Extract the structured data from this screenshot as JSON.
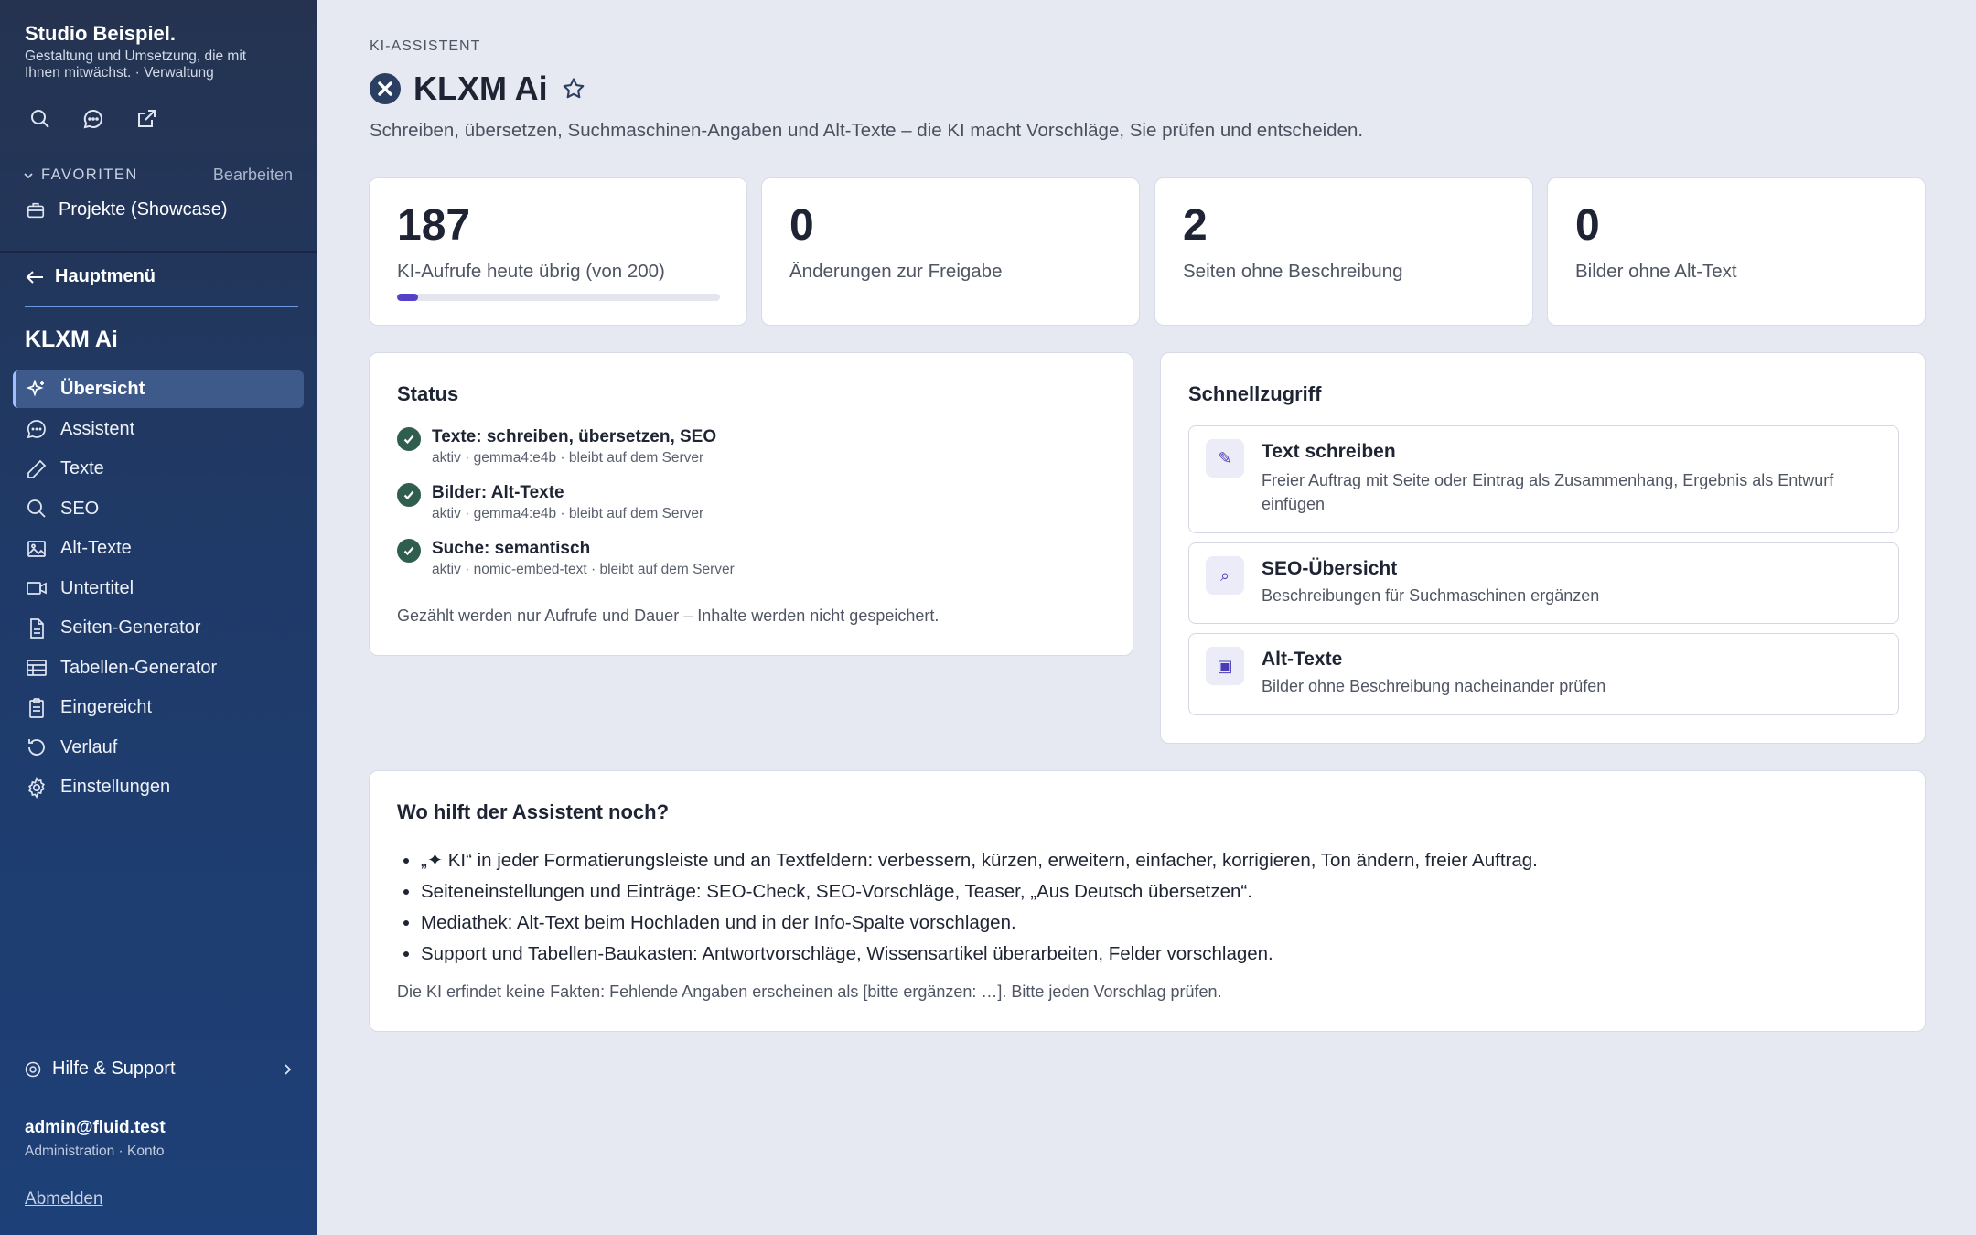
{
  "sidebar": {
    "brand_title": "Studio Beispiel.",
    "brand_subtitle": "Gestaltung und Umsetzung, die mit Ihnen mitwächst. · Verwaltung",
    "top_icons": [
      "search-icon",
      "chat-icon",
      "external-link-icon"
    ],
    "favorites_label": "FAVORITEN",
    "favorites_edit": "Bearbeiten",
    "favorite_item": "Projekte (Showcase)",
    "back_label": "Hauptmenü",
    "section_title": "KLXM Ai",
    "items": [
      {
        "label": "Übersicht",
        "icon": "sparkle-icon",
        "active": true
      },
      {
        "label": "Assistent",
        "icon": "chat-icon"
      },
      {
        "label": "Texte",
        "icon": "pencil-icon"
      },
      {
        "label": "SEO",
        "icon": "search-icon"
      },
      {
        "label": "Alt-Texte",
        "icon": "image-icon"
      },
      {
        "label": "Untertitel",
        "icon": "video-icon"
      },
      {
        "label": "Seiten-Generator",
        "icon": "file-icon"
      },
      {
        "label": "Tabellen-Generator",
        "icon": "table-icon"
      },
      {
        "label": "Eingereicht",
        "icon": "clipboard-icon"
      },
      {
        "label": "Verlauf",
        "icon": "history-icon"
      },
      {
        "label": "Einstellungen",
        "icon": "gear-icon"
      }
    ],
    "help_label": "Hilfe & Support",
    "user_email": "admin@fluid.test",
    "user_role": "Administration · Konto",
    "logout_label": "Abmelden"
  },
  "header": {
    "eyebrow": "KI-ASSISTENT",
    "title": "KLXM Ai",
    "lead": "Schreiben, übersetzen, Suchmaschinen-Angaben und Alt-Texte – die KI macht Vorschläge, Sie prüfen und entscheiden."
  },
  "stats": [
    {
      "value": "187",
      "label": "KI-Aufrufe heute übrig (von 200)",
      "progress": 0.065
    },
    {
      "value": "0",
      "label": "Änderungen zur Freigabe"
    },
    {
      "value": "2",
      "label": "Seiten ohne Beschreibung"
    },
    {
      "value": "0",
      "label": "Bilder ohne Alt-Text"
    }
  ],
  "status": {
    "title": "Status",
    "items": [
      {
        "name": "Texte: schreiben, übersetzen, SEO",
        "meta": "aktiv · gemma4:e4b · bleibt auf dem Server"
      },
      {
        "name": "Bilder: Alt-Texte",
        "meta": "aktiv · gemma4:e4b · bleibt auf dem Server"
      },
      {
        "name": "Suche: semantisch",
        "meta": "aktiv · nomic-embed-text · bleibt auf dem Server"
      }
    ],
    "note": "Gezählt werden nur Aufrufe und Dauer – Inhalte werden nicht gespeichert."
  },
  "quick": {
    "title": "Schnellzugriff",
    "items": [
      {
        "icon": "✎",
        "name": "Text schreiben",
        "desc": "Freier Auftrag mit Seite oder Eintrag als Zusammenhang, Ergebnis als Entwurf einfügen"
      },
      {
        "icon": "⌕",
        "name": "SEO-Übersicht",
        "desc": "Beschreibungen für Suchmaschinen ergänzen"
      },
      {
        "icon": "▣",
        "name": "Alt-Texte",
        "desc": "Bilder ohne Beschreibung nacheinander prüfen"
      }
    ]
  },
  "help_card": {
    "title": "Wo hilft der Assistent noch?",
    "bullets": [
      "„✦ KI“ in jeder Formatierungsleiste und an Textfeldern: verbessern, kürzen, erweitern, einfacher, korrigieren, Ton ändern, freier Auftrag.",
      "Seiteneinstellungen und Einträge: SEO-Check, SEO-Vorschläge, Teaser, „Aus Deutsch übersetzen“.",
      "Mediathek: Alt-Text beim Hochladen und in der Info-Spalte vorschlagen.",
      "Support und Tabellen-Baukasten: Antwortvorschläge, Wissensartikel überarbeiten, Felder vorschlagen."
    ],
    "note": "Die KI erfindet keine Fakten: Fehlende Angaben erscheinen als [bitte ergänzen: …]. Bitte jeden Vorschlag prüfen."
  },
  "colors": {
    "accent": "#5440c9",
    "sidebar": "#1f3a68",
    "success": "#2f5e4e"
  }
}
